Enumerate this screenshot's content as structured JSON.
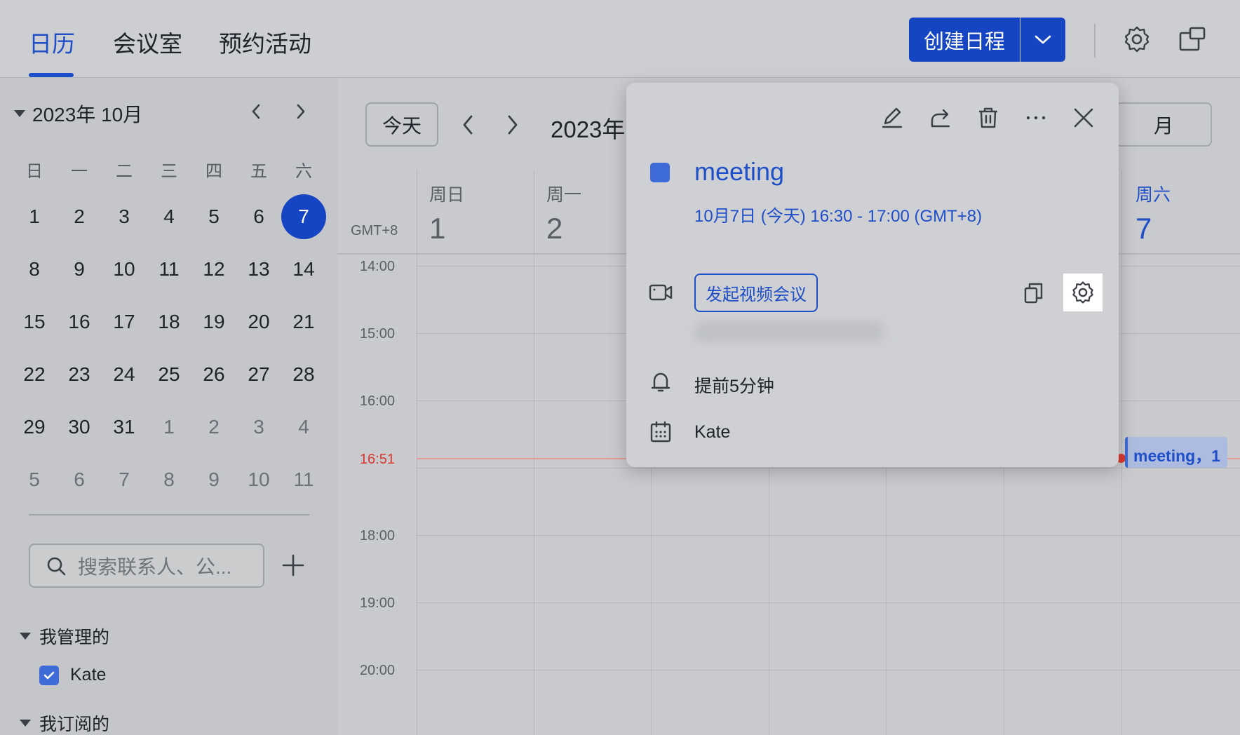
{
  "header": {
    "tabs": [
      {
        "label": "日历",
        "active": true
      },
      {
        "label": "会议室",
        "active": false
      },
      {
        "label": "预约活动",
        "active": false
      }
    ],
    "create_label": "创建日程",
    "accent_color": "#1645c4"
  },
  "mini_calendar": {
    "month_label": "2023年 10月",
    "weekdays": [
      "日",
      "一",
      "二",
      "三",
      "四",
      "五",
      "六"
    ],
    "weeks": [
      [
        "1",
        "2",
        "3",
        "4",
        "5",
        "6",
        "7"
      ],
      [
        "8",
        "9",
        "10",
        "11",
        "12",
        "13",
        "14"
      ],
      [
        "15",
        "16",
        "17",
        "18",
        "19",
        "20",
        "21"
      ],
      [
        "22",
        "23",
        "24",
        "25",
        "26",
        "27",
        "28"
      ],
      [
        "29",
        "30",
        "31",
        "1",
        "2",
        "3",
        "4"
      ],
      [
        "5",
        "6",
        "7",
        "8",
        "9",
        "10",
        "11"
      ]
    ],
    "today": "7"
  },
  "sidebar": {
    "search_placeholder": "搜索联系人、公...",
    "group_managed": "我管理的",
    "calendar_name": "Kate",
    "group_subscribed": "我订阅的"
  },
  "toolbar": {
    "today_label": "今天",
    "month_label": "2023年",
    "view_label": "月"
  },
  "grid": {
    "timezone": "GMT+8",
    "columns": [
      {
        "dow": "周日",
        "date": "1"
      },
      {
        "dow": "周一",
        "date": "2"
      },
      {
        "dow": "周六",
        "date": "7"
      }
    ],
    "times": [
      "14:00",
      "15:00",
      "16:00",
      "18:00",
      "19:00",
      "20:00"
    ],
    "now_time": "16:51",
    "event_chip": "meeting，1"
  },
  "popup": {
    "title": "meeting",
    "time": "10月7日 (今天) 16:30 - 17:00 (GMT+8)",
    "video_button": "发起视频会议",
    "reminder": "提前5分钟",
    "calendar": "Kate",
    "event_color": "#3f6bd8"
  }
}
